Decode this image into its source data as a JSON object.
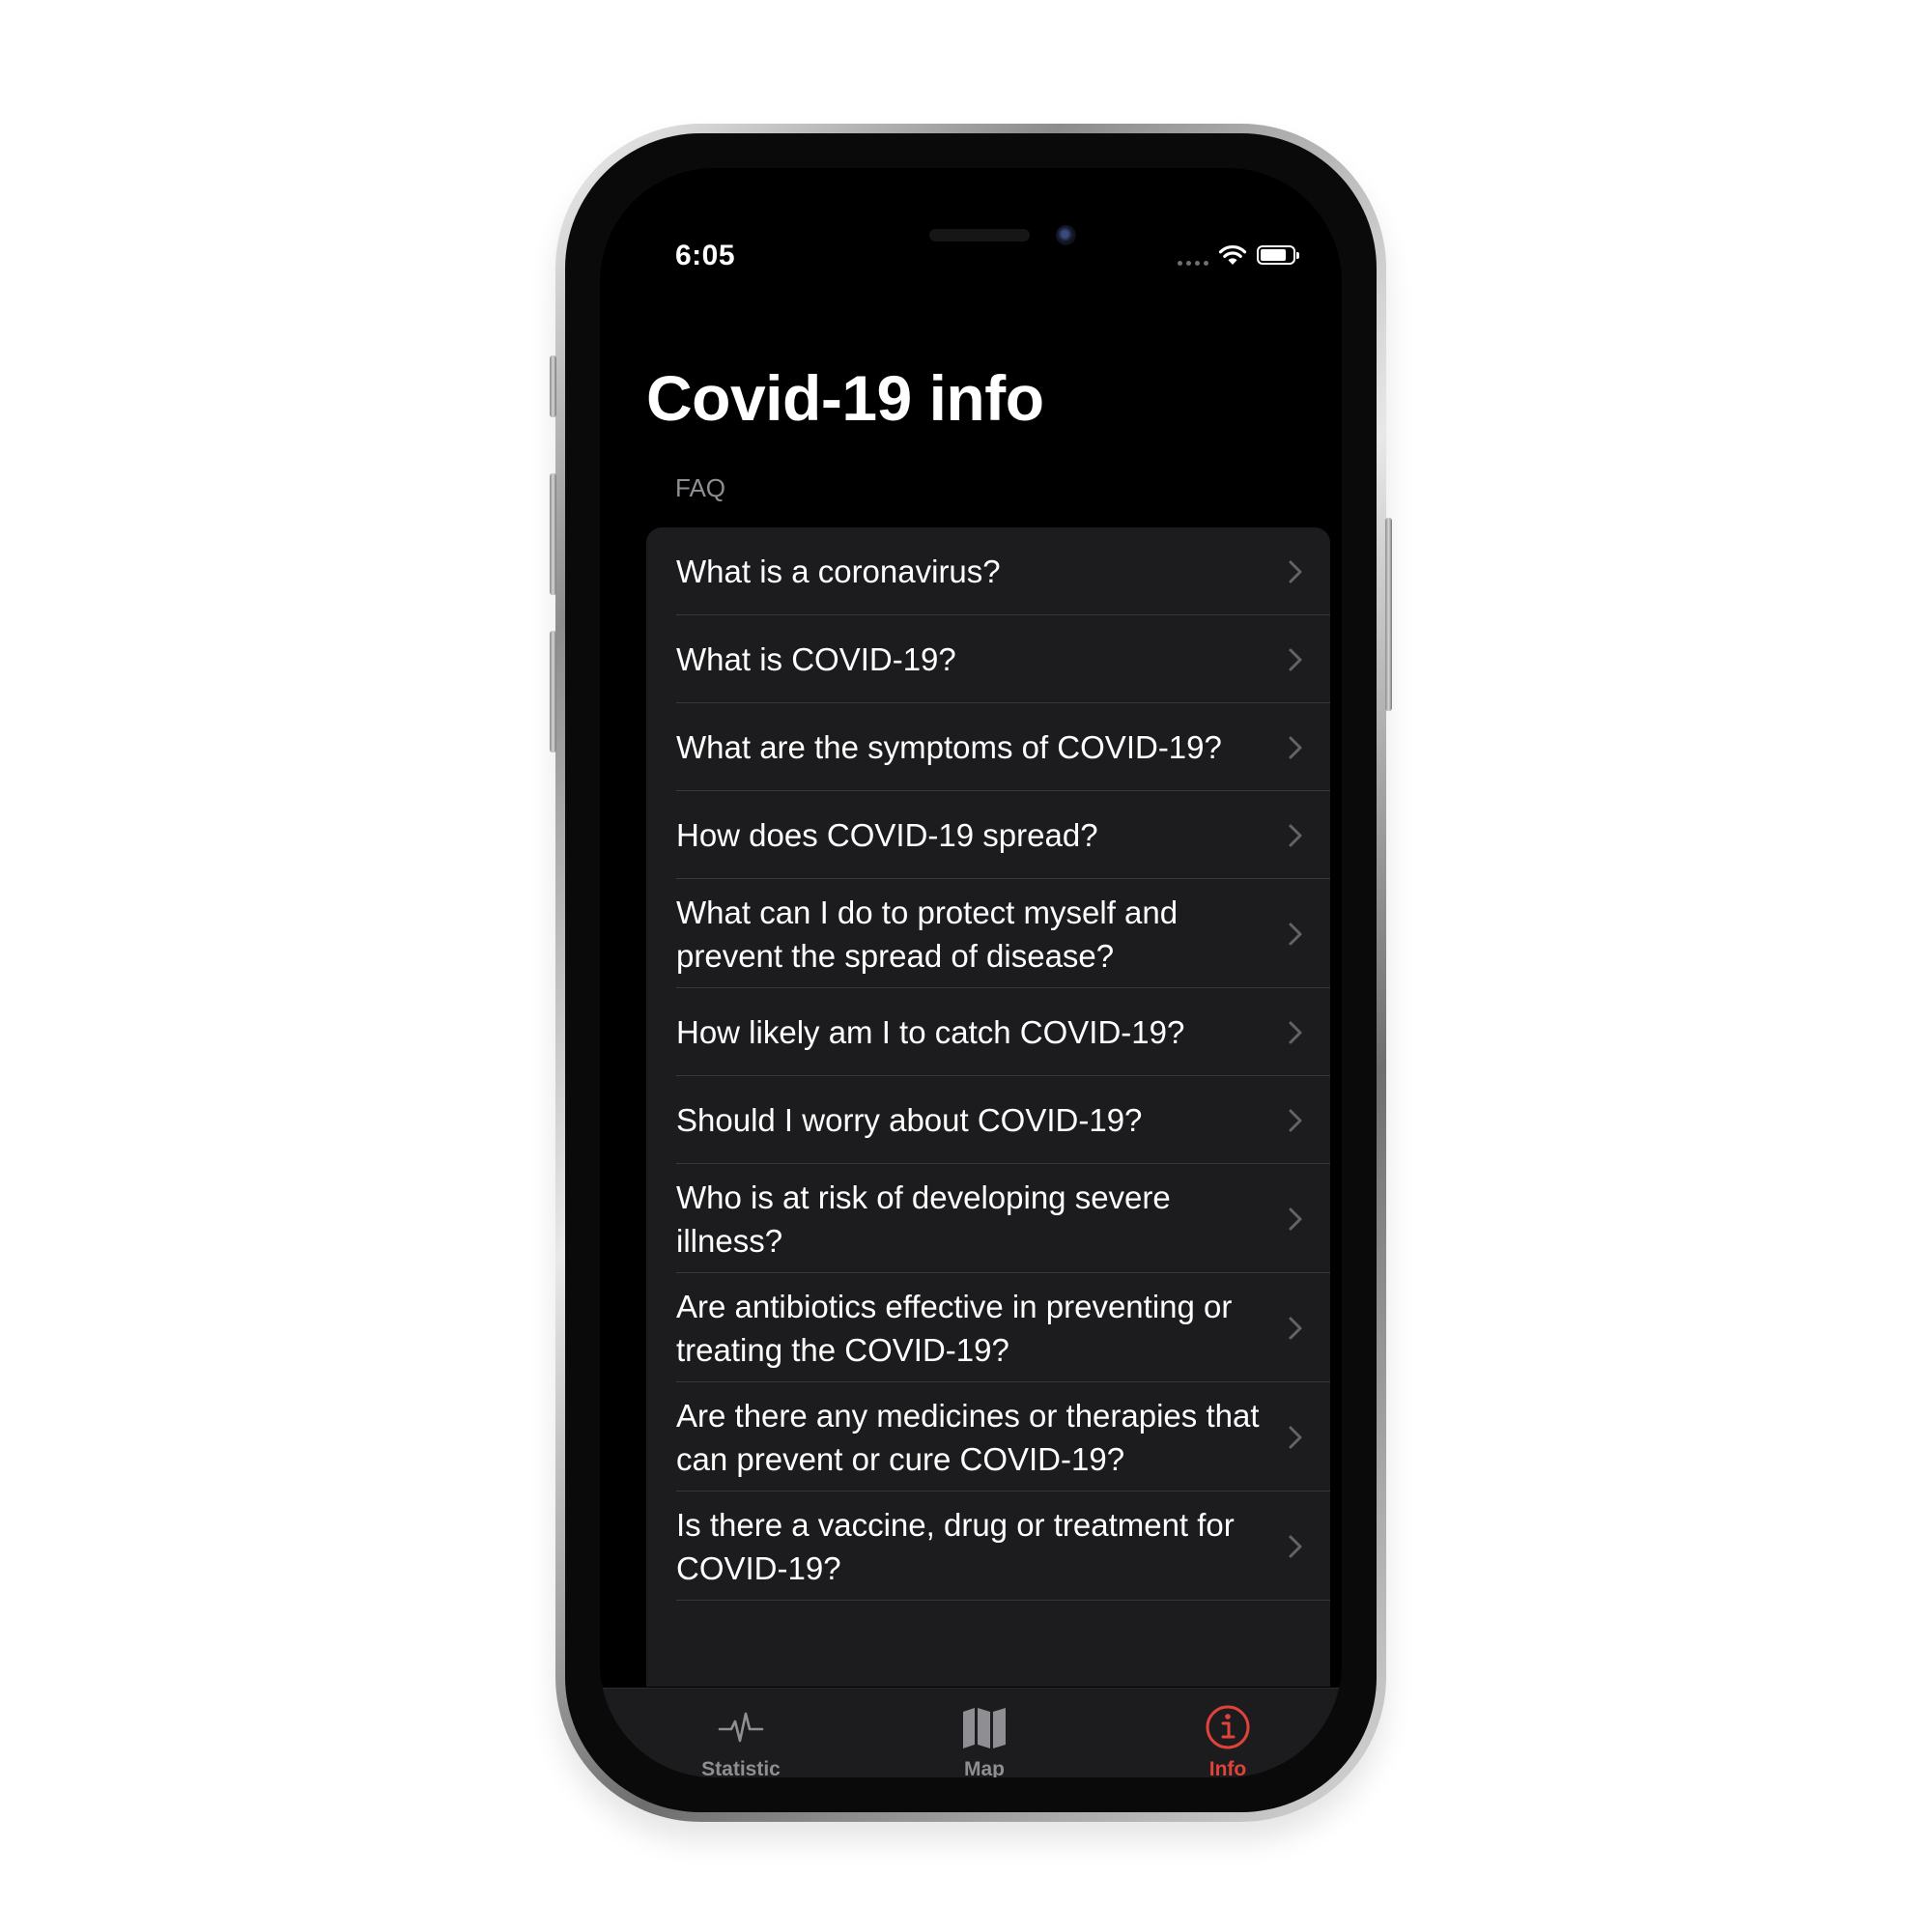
{
  "status_bar": {
    "time": "6:05",
    "battery_level": 0.8
  },
  "page": {
    "title": "Covid-19 info",
    "section_header": "FAQ"
  },
  "faq": {
    "items": [
      {
        "label": "What is a coronavirus?"
      },
      {
        "label": "What is COVID-19?"
      },
      {
        "label": "What are the symptoms of COVID-19?"
      },
      {
        "label": "How does COVID-19 spread?"
      },
      {
        "label": "What can I do to protect myself and prevent the spread of disease?"
      },
      {
        "label": "How likely am I to catch COVID-19?"
      },
      {
        "label": "Should I worry about COVID-19?"
      },
      {
        "label": "Who is at risk of developing severe illness?"
      },
      {
        "label": "Are antibiotics effective in preventing or treating the COVID-19?"
      },
      {
        "label": "Are there any medicines or therapies that can prevent or cure COVID-19?"
      },
      {
        "label": "Is there a vaccine, drug or treatment for COVID-19?"
      }
    ]
  },
  "tab_bar": {
    "tabs": [
      {
        "label": "Statistic",
        "icon": "waveform-icon",
        "selected": false
      },
      {
        "label": "Map",
        "icon": "map-icon",
        "selected": false
      },
      {
        "label": "Info",
        "icon": "info-circle-icon",
        "selected": true
      }
    ]
  },
  "colors": {
    "accent": "#e0433a",
    "inactive_tab": "#8e8e93",
    "background": "#000000",
    "cell_background": "#1c1c1e"
  }
}
